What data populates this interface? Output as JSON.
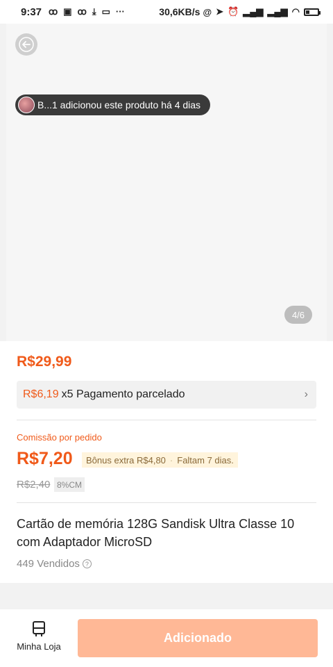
{
  "status_bar": {
    "time": "9:37",
    "network_speed": "30,6KB/s",
    "icons": [
      "people-icon",
      "shop-icon",
      "people-icon",
      "download-icon",
      "photo-icon",
      "more-dots-icon",
      "at-icon",
      "location-arrow-icon",
      "alarm-icon",
      "signal-icon",
      "signal-icon",
      "wifi-icon",
      "battery-icon"
    ]
  },
  "gallery": {
    "back_icon": "arrow-left-icon",
    "activity_text": "B...1 adicionou este produto há 4 dias",
    "page_indicator": "4/6"
  },
  "product": {
    "price": "R$29,99",
    "installment": {
      "amount": "R$6,19",
      "multiplier_text": "x5 Pagamento parcelado",
      "chevron": "›"
    },
    "commission": {
      "label": "Comissão por pedido",
      "value": "R$7,20",
      "bonus_text": "Bônus extra R$4,80",
      "separator": "·",
      "remaining_text": "Faltam 7 dias.",
      "old_value": "R$2,40",
      "rate_chip": "8%CM"
    },
    "title": "Cartão de memória 128G Sandisk Ultra Classe 10 com Adaptador MicroSD",
    "sold": "449 Vendidos",
    "info_icon": "?"
  },
  "bottom_bar": {
    "store_label": "Minha Loja",
    "add_button_label": "Adicionado"
  },
  "colors": {
    "accent": "#f05a1a",
    "button_disabled": "#ffb896",
    "bonus_bg": "#fff4dc"
  }
}
